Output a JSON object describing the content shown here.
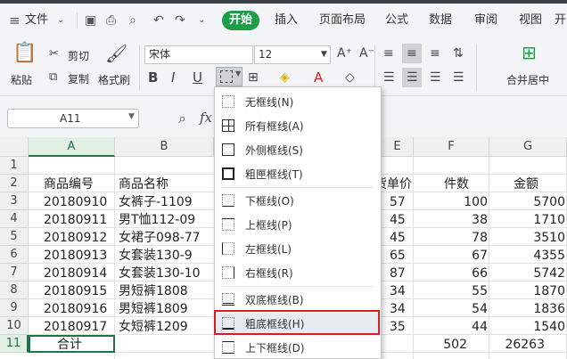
{
  "menu": {
    "file": "文件",
    "tabs": [
      "开始",
      "插入",
      "页面布局",
      "公式",
      "数据",
      "审阅",
      "视图",
      "开"
    ],
    "active_color": "#1a9e4a"
  },
  "ribbon": {
    "paste": "粘贴",
    "cut": "剪切",
    "copy": "复制",
    "format_painter": "格式刷",
    "font_name": "宋体",
    "font_size": "12",
    "merge_center": "合并居中",
    "bold": "B",
    "italic": "I",
    "underline": "U",
    "font_color": "A"
  },
  "formula_bar": {
    "name_box": "A11",
    "fx": "fx"
  },
  "columns": [
    "A",
    "B",
    "E",
    "F",
    "G"
  ],
  "rows": [
    "1",
    "2",
    "3",
    "4",
    "5",
    "6",
    "7",
    "8",
    "9",
    "10",
    "11"
  ],
  "table": {
    "headers": [
      "商品编号",
      "商品名称",
      "进货单价",
      "件数",
      "金额"
    ],
    "rows": [
      [
        "20180910",
        "女裤子-1109",
        "57",
        "100",
        "5700"
      ],
      [
        "20180911",
        "男T恤112-09",
        "45",
        "38",
        "1710"
      ],
      [
        "20180912",
        "女裙子098-77",
        "45",
        "78",
        "3510"
      ],
      [
        "20180913",
        "女套装130-9",
        "65",
        "67",
        "4355"
      ],
      [
        "20180914",
        "女套装130-10",
        "87",
        "66",
        "5742"
      ],
      [
        "20180915",
        "男短裤1808",
        "34",
        "55",
        "1870"
      ],
      [
        "20180916",
        "男短裤1809",
        "34",
        "54",
        "1836"
      ],
      [
        "20180917",
        "女短裤1209",
        "35",
        "44",
        "1540"
      ]
    ],
    "total": [
      "合计",
      "502",
      "26263"
    ]
  },
  "border_menu": {
    "items": [
      "无框线(N)",
      "所有框线(A)",
      "外侧框线(S)",
      "粗匣框线(T)",
      "下框线(O)",
      "上框线(P)",
      "左框线(L)",
      "右框线(R)",
      "双底框线(B)",
      "粗底框线(H)",
      "上下框线(D)"
    ],
    "highlighted": "粗底框线(H)",
    "highlight_color": "#d81e1e"
  }
}
